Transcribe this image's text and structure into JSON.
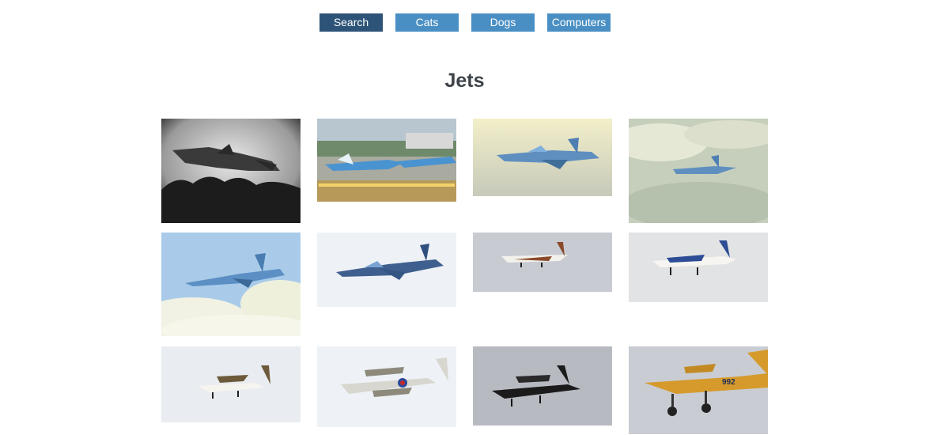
{
  "nav": {
    "items": [
      {
        "label": "Search",
        "active": true
      },
      {
        "label": "Cats",
        "active": false
      },
      {
        "label": "Dogs",
        "active": false
      },
      {
        "label": "Computers",
        "active": false
      }
    ]
  },
  "page": {
    "title": "Jets"
  },
  "gallery": {
    "photos": [
      {
        "subject": "black-and-white stealth fighter taking off",
        "registration": ""
      },
      {
        "subject": "airliners parked at airfield",
        "registration": ""
      },
      {
        "subject": "blue camouflage fighter jet",
        "registration": ""
      },
      {
        "subject": "blue camouflage fighter jet in cloudy sky",
        "registration": ""
      },
      {
        "subject": "blue camouflage fighter jet over clouds",
        "registration": ""
      },
      {
        "subject": "blue camouflage fighter jet",
        "registration": ""
      },
      {
        "subject": "white light aircraft",
        "registration": ""
      },
      {
        "subject": "white and blue light aircraft",
        "registration": ""
      },
      {
        "subject": "white light aircraft",
        "registration": ""
      },
      {
        "subject": "RAF biplane with roundels",
        "registration": ""
      },
      {
        "subject": "dark single-engine aircraft",
        "registration": ""
      },
      {
        "subject": "yellow trainer aircraft",
        "registration": "992"
      }
    ]
  }
}
